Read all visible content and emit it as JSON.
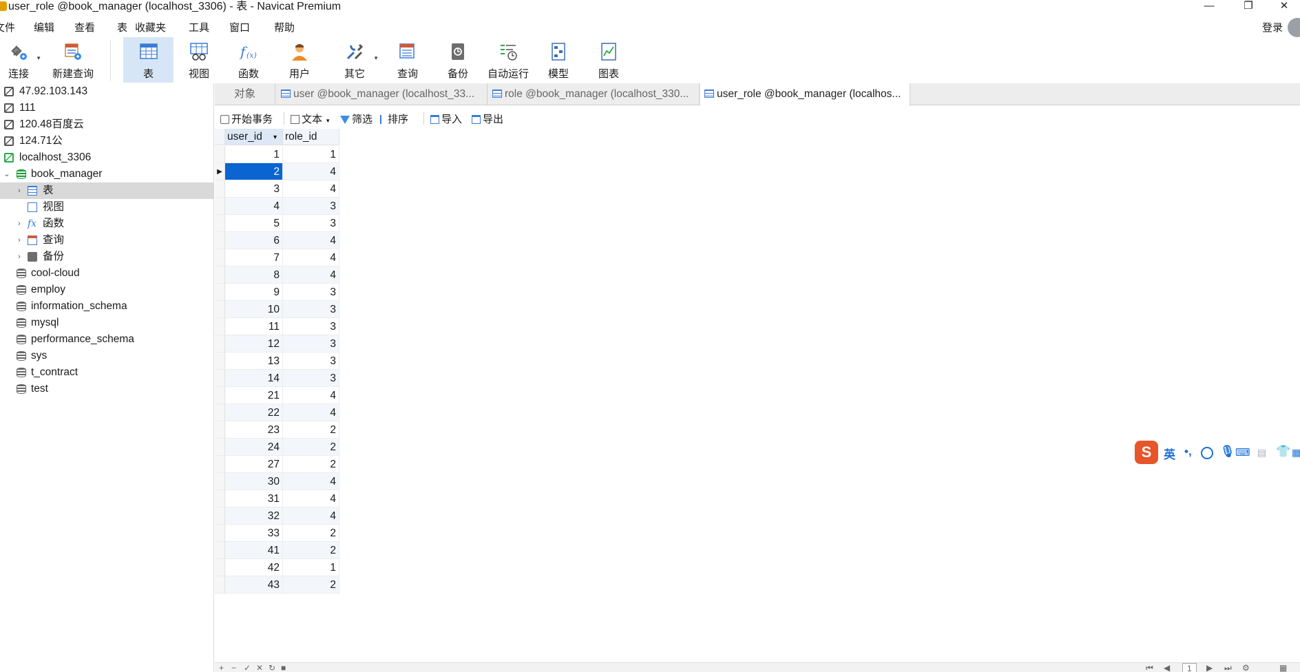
{
  "window": {
    "title": "user_role @book_manager (localhost_3306) - 表 - Navicat Premium",
    "minimize": "—",
    "maximize": "❐",
    "close": "✕"
  },
  "menu": [
    "文件",
    "编辑",
    "查看",
    "表",
    "收藏夹",
    "工具",
    "窗口",
    "帮助"
  ],
  "login_label": "登录",
  "toolbar": [
    {
      "label": "连接",
      "icon": "plug-icon"
    },
    {
      "label": "新建查询",
      "icon": "new-query-icon"
    },
    {
      "label": "表",
      "icon": "table-icon"
    },
    {
      "label": "视图",
      "icon": "view-icon"
    },
    {
      "label": "函数",
      "icon": "function-icon"
    },
    {
      "label": "用户",
      "icon": "user-icon"
    },
    {
      "label": "其它",
      "icon": "tools-icon"
    },
    {
      "label": "查询",
      "icon": "query-icon"
    },
    {
      "label": "备份",
      "icon": "backup-icon"
    },
    {
      "label": "自动运行",
      "icon": "auto-run-icon"
    },
    {
      "label": "模型",
      "icon": "model-icon"
    },
    {
      "label": "图表",
      "icon": "chart-icon"
    }
  ],
  "tree": [
    {
      "label": "47.92.103.143"
    },
    {
      "label": "111"
    },
    {
      "label": "120.48百度云"
    },
    {
      "label": "124.71公"
    },
    {
      "label": "localhost_3306"
    },
    {
      "label": "book_manager"
    },
    {
      "label": "表"
    },
    {
      "label": "视图"
    },
    {
      "label": "函数"
    },
    {
      "label": "查询"
    },
    {
      "label": "备份"
    },
    {
      "label": "cool-cloud"
    },
    {
      "label": "employ"
    },
    {
      "label": "information_schema"
    },
    {
      "label": "mysql"
    },
    {
      "label": "performance_schema"
    },
    {
      "label": "sys"
    },
    {
      "label": "t_contract"
    },
    {
      "label": "test"
    }
  ],
  "tabs": [
    {
      "label": "对象"
    },
    {
      "label": "user @book_manager (localhost_33..."
    },
    {
      "label": "role @book_manager (localhost_330..."
    },
    {
      "label": "user_role @book_manager (localhos..."
    }
  ],
  "subtoolbar": {
    "begin_tx": "开始事务",
    "text": "文本",
    "filter": "筛选",
    "sort": "排序",
    "import": "导入",
    "export": "导出"
  },
  "grid": {
    "columns": [
      "user_id",
      "role_id"
    ],
    "rows": [
      [
        "1",
        "1"
      ],
      [
        "2",
        "4"
      ],
      [
        "3",
        "4"
      ],
      [
        "4",
        "3"
      ],
      [
        "5",
        "3"
      ],
      [
        "6",
        "4"
      ],
      [
        "7",
        "4"
      ],
      [
        "8",
        "4"
      ],
      [
        "9",
        "3"
      ],
      [
        "10",
        "3"
      ],
      [
        "11",
        "3"
      ],
      [
        "12",
        "3"
      ],
      [
        "13",
        "3"
      ],
      [
        "14",
        "3"
      ],
      [
        "21",
        "4"
      ],
      [
        "22",
        "4"
      ],
      [
        "23",
        "2"
      ],
      [
        "24",
        "2"
      ],
      [
        "27",
        "2"
      ],
      [
        "30",
        "4"
      ],
      [
        "31",
        "4"
      ],
      [
        "32",
        "4"
      ],
      [
        "33",
        "2"
      ],
      [
        "41",
        "2"
      ],
      [
        "42",
        "1"
      ],
      [
        "43",
        "2"
      ]
    ],
    "selected_row": 1
  },
  "pager": {
    "page": "1"
  },
  "ime": {
    "logo": "S",
    "mode": "英",
    "punct": "•,"
  }
}
